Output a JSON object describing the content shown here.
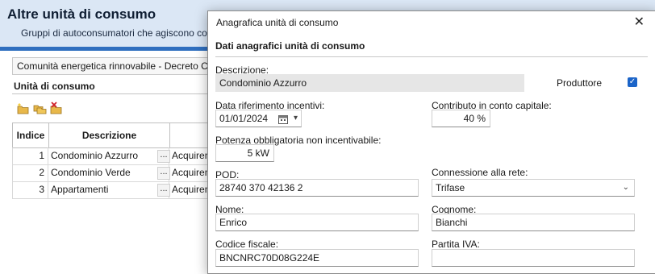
{
  "main": {
    "title": "Altre unità di consumo",
    "subtitle": "Gruppi di autoconsumatori che agiscono collettivamente",
    "community": "Comunità energetica rinnovabile - Decreto CACER",
    "section_label": "Unità di consumo",
    "toolbar": [
      "add-icon",
      "copy-icon",
      "delete-icon"
    ],
    "table": {
      "headers": {
        "index": "Indice",
        "description": "Descrizione"
      },
      "rows": [
        {
          "index": "1",
          "description": "Condominio Azzurro",
          "ellipsis": "...",
          "type": "Acquirente",
          "checked": true
        },
        {
          "index": "2",
          "description": "Condominio Verde",
          "ellipsis": "...",
          "type": "Acquirente",
          "checked": true
        },
        {
          "index": "3",
          "description": "Appartamenti",
          "ellipsis": "...",
          "type": "Acquirente",
          "checked": false
        }
      ],
      "right_header_fragment": "ut"
    }
  },
  "dialog": {
    "title": "Anagrafica unità di consumo",
    "close_label": "✕",
    "section": "Dati anagrafici unità di consumo",
    "fields": {
      "descrizione": {
        "label": "Descrizione:",
        "value": "Condominio Azzurro"
      },
      "produttore": {
        "label": "Produttore",
        "checked": true,
        "check_glyph": "✓"
      },
      "data_riferimento": {
        "label": "Data riferimento incentivi:",
        "value": "01/01/2024"
      },
      "contributo": {
        "label": "Contributo in conto capitale:",
        "value": "40 %"
      },
      "potenza": {
        "label": "Potenza obbligatoria non incentivabile:",
        "value": "5 kW"
      },
      "pod": {
        "label": "POD:",
        "value": "28740 370 42136 2"
      },
      "connessione": {
        "label": "Connessione alla rete:",
        "value": "Trifase"
      },
      "nome": {
        "label": "Nome:",
        "value": "Enrico"
      },
      "cognome": {
        "label": "Cognome:",
        "value": "Bianchi"
      },
      "codice_fiscale": {
        "label": "Codice fiscale:",
        "value": "BNCNRC70D08G224E"
      },
      "partita_iva": {
        "label": "Partita IVA:",
        "value": ""
      }
    }
  },
  "colors": {
    "accent": "#2f6fbf",
    "header_bg": "#dbe7f5",
    "check_blue": "#1b64c8"
  }
}
